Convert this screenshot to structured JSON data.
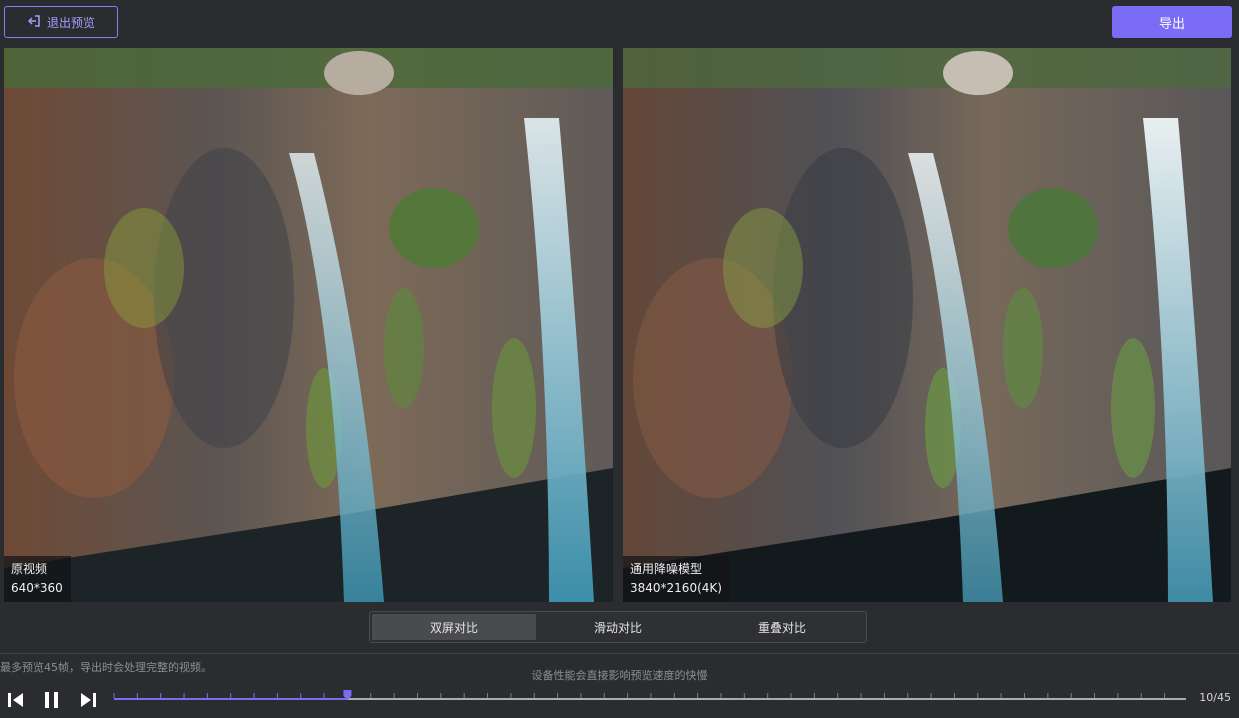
{
  "toolbar": {
    "exit_label": "退出预览",
    "export_label": "导出",
    "accent": "#7b6cf6"
  },
  "panes": {
    "left": {
      "title": "原视频",
      "resolution": "640*360"
    },
    "right": {
      "title": "通用降噪模型",
      "resolution": "3840*2160(4K)"
    }
  },
  "modes": {
    "items": [
      "双屏对比",
      "滑动对比",
      "重叠对比"
    ],
    "active": "双屏对比"
  },
  "hints": {
    "left": "最多预览45帧，导出时会处理完整的视频。",
    "center": "设备性能会直接影响预览速度的快慢"
  },
  "playback": {
    "current_frame": 10,
    "total_frames": 45,
    "counter_text": "10/45"
  },
  "icons": {
    "exit": "exit-arrow-icon",
    "prev": "step-backward-icon",
    "pause": "pause-icon",
    "next": "step-forward-icon"
  }
}
